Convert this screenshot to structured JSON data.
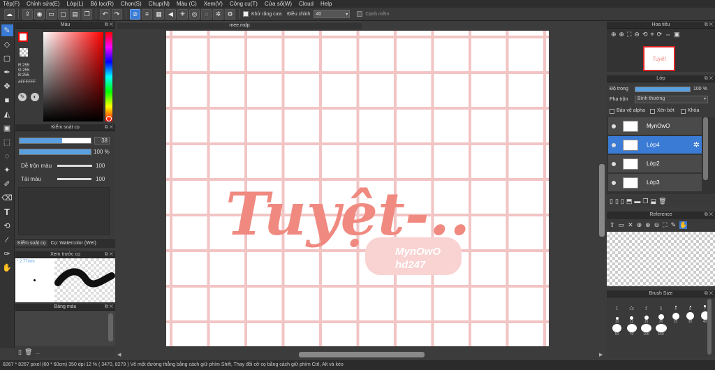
{
  "menu": [
    "Tệp(F)",
    "Chỉnh sửa(E)",
    "Lớp(L)",
    "Bộ lọc(R)",
    "Chọn(S)",
    "Chụp(N)",
    "Màu (C)",
    "Xem(V)",
    "Công cụ(T)",
    "Cửa sổ(W)",
    "Cloud",
    "Help"
  ],
  "toolbar": {
    "antialias_label": "Khử răng cưa",
    "adjust_label": "Điều chỉnh",
    "adjust_value": "40",
    "edge_label": "Cạnh mềm"
  },
  "color_panel": {
    "title": "Màu",
    "r": "R:255",
    "g": "G:255",
    "b": "B:255",
    "hex": "#FFFFFF",
    "primary": "#FFFFFF",
    "secondary": "#000000"
  },
  "brush_control": {
    "title": "Kiểm soát cọ",
    "size": "38",
    "opacity": "100 %",
    "blend_label": "Dễ trộn màu",
    "blend_value": "100",
    "load_label": "Tải màu",
    "load_value": "100",
    "size_fill": 0.6,
    "opacity_fill": 1.0,
    "blend_fill": 1.0,
    "load_fill": 0.95
  },
  "brush_tabs": {
    "tab1": "Kiểm soát cọ",
    "tab2": "Cọ: Watercolor (Wet)"
  },
  "brush_preview": {
    "title": "Xem trước cọ",
    "size": "* 2.77mm"
  },
  "palette": {
    "title": "Bảng màu",
    "dots": "..."
  },
  "canvas": {
    "tab": "mee.mdp",
    "art_text": "Tuyệt-..",
    "watermark_line1": "MynOwO",
    "watermark_line2": "hd247"
  },
  "navigator": {
    "title": "Hoa tiêu",
    "thumb_text": "Tuyệt"
  },
  "layers": {
    "title": "Lớp",
    "opacity_label": "Độ trong",
    "opacity_value": "100 %",
    "blend_label": "Pha trộn",
    "blend_value": "Bình thường",
    "protect_alpha": "Bảo vệ alpha",
    "clip": "Xén bớt",
    "lock": "Khóa",
    "items": [
      {
        "name": "MynOwO"
      },
      {
        "name": "Lớp4"
      },
      {
        "name": "Lớp2"
      },
      {
        "name": "Lớp3"
      }
    ]
  },
  "reference": {
    "title": "Reference"
  },
  "brush_size": {
    "title": "Brush Size",
    "labels": [
      "1",
      "1.5",
      "2",
      "3",
      "4",
      "5",
      "7",
      "10",
      "12",
      "15",
      "20",
      "25",
      "30",
      "40",
      "50",
      "70",
      "100",
      "150"
    ]
  },
  "status": {
    "text": "8267 * 8267 pixel  (60 * 60cm)  350 dpi  12 %  ( 3470, 8279 )  Vẽ một đường thẳng bằng cách giữ phím Shift, Thay đổi cỡ cọ bằng cách giữ phím Ctrl, Alt và kéo"
  },
  "colors": {
    "accent": "#3a7bd5",
    "grid": "#f2c4c4",
    "art": "#f08a80",
    "watermark_bg": "#f9d2d2"
  }
}
